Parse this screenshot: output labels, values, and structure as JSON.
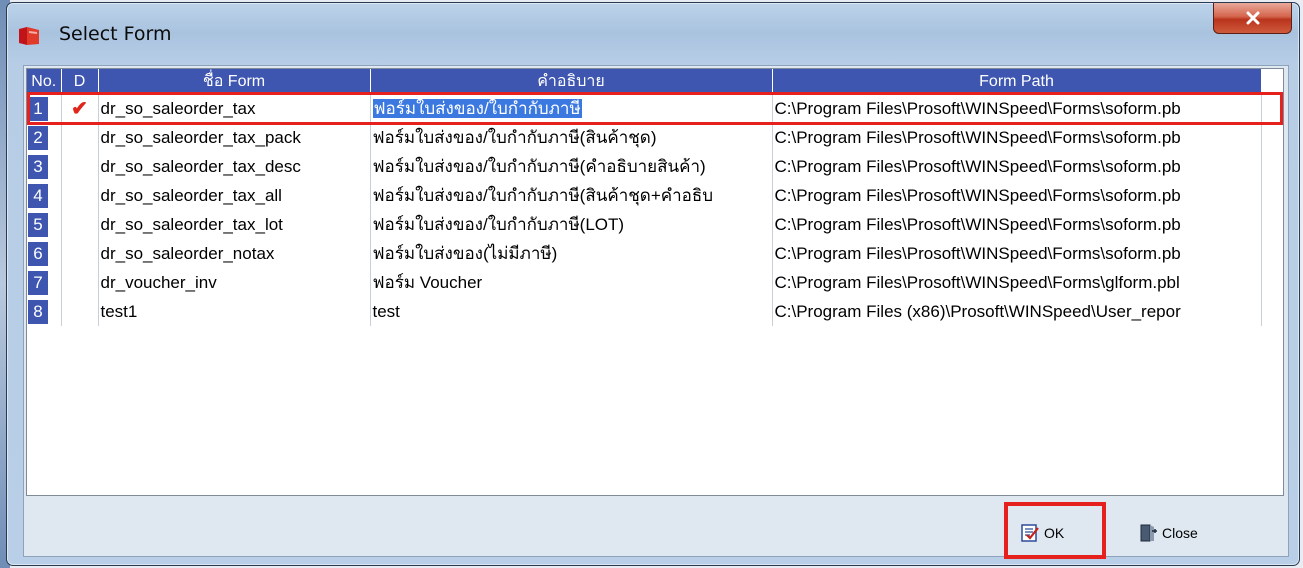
{
  "window": {
    "title": "Select Form",
    "close_label": "x"
  },
  "table": {
    "columns": [
      "No.",
      "D",
      "ชื่อ Form",
      "คำอธิบาย",
      "Form Path"
    ],
    "rows": [
      {
        "no": "1",
        "d": "✔",
        "name": "dr_so_saleorder_tax",
        "desc": "ฟอร์มใบส่งของ/ใบกำกับภาษี",
        "path": "C:\\Program Files\\Prosoft\\WINSpeed\\Forms\\soform.pb"
      },
      {
        "no": "2",
        "d": "",
        "name": "dr_so_saleorder_tax_pack",
        "desc": "ฟอร์มใบส่งของ/ใบกำกับภาษี(สินค้าชุด)",
        "path": "C:\\Program Files\\Prosoft\\WINSpeed\\Forms\\soform.pb"
      },
      {
        "no": "3",
        "d": "",
        "name": "dr_so_saleorder_tax_desc",
        "desc": "ฟอร์มใบส่งของ/ใบกำกับภาษี(คำอธิบายสินค้า)",
        "path": "C:\\Program Files\\Prosoft\\WINSpeed\\Forms\\soform.pb"
      },
      {
        "no": "4",
        "d": "",
        "name": "dr_so_saleorder_tax_all",
        "desc": "ฟอร์มใบส่งของ/ใบกำกับภาษี(สินค้าชุด+คำอธิบ",
        "path": "C:\\Program Files\\Prosoft\\WINSpeed\\Forms\\soform.pb"
      },
      {
        "no": "5",
        "d": "",
        "name": "dr_so_saleorder_tax_lot",
        "desc": "ฟอร์มใบส่งของ/ใบกำกับภาษี(LOT)",
        "path": "C:\\Program Files\\Prosoft\\WINSpeed\\Forms\\soform.pb"
      },
      {
        "no": "6",
        "d": "",
        "name": "dr_so_saleorder_notax",
        "desc": "ฟอร์มใบส่งของ(ไม่มีภาษี)",
        "path": "C:\\Program Files\\Prosoft\\WINSpeed\\Forms\\soform.pb"
      },
      {
        "no": "7",
        "d": "",
        "name": "dr_voucher_inv",
        "desc": "ฟอร์ม Voucher",
        "path": "C:\\Program Files\\Prosoft\\WINSpeed\\Forms\\glform.pbl"
      },
      {
        "no": "8",
        "d": "",
        "name": "test1",
        "desc": "test",
        "path": "C:\\Program Files (x86)\\Prosoft\\WINSpeed\\User_repor"
      }
    ]
  },
  "buttons": {
    "ok_label": "OK",
    "close_label": "Close"
  },
  "colors": {
    "header": "#3e56b0",
    "selection": "#3b79e0",
    "highlight": "#e5201d",
    "check": "#e0261c"
  }
}
